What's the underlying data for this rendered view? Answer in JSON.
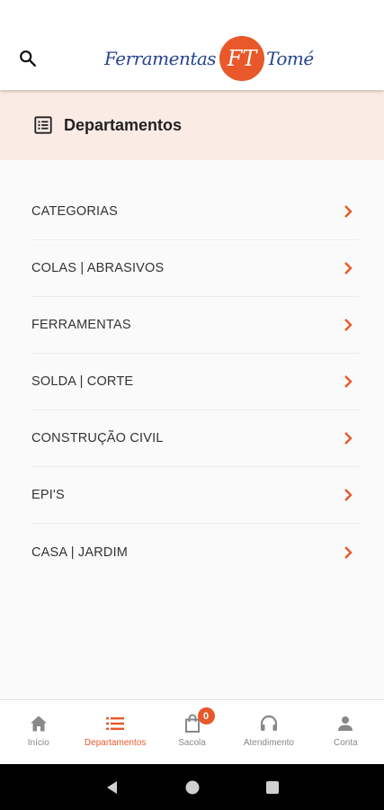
{
  "header": {
    "logo_left": "Ferramentas",
    "logo_mark": "FT",
    "logo_right": "Tomé"
  },
  "section": {
    "title": "Departamentos"
  },
  "menu": {
    "items": [
      {
        "label": "CATEGORIAS"
      },
      {
        "label": "COLAS | ABRASIVOS"
      },
      {
        "label": "FERRAMENTAS"
      },
      {
        "label": "SOLDA | CORTE"
      },
      {
        "label": "CONSTRUÇÃO CIVIL"
      },
      {
        "label": "EPI'S"
      },
      {
        "label": "CASA | JARDIM"
      }
    ]
  },
  "bottom_nav": {
    "items": [
      {
        "label": "Início",
        "icon": "home-icon"
      },
      {
        "label": "Departamentos",
        "icon": "list-icon",
        "active": true
      },
      {
        "label": "Sacola",
        "icon": "bag-icon",
        "badge": "0"
      },
      {
        "label": "Atendimento",
        "icon": "headset-icon"
      },
      {
        "label": "Conta",
        "icon": "person-icon"
      }
    ]
  },
  "colors": {
    "accent": "#e8582a",
    "brand_blue": "#27458f",
    "header_bg": "#fbebe5"
  }
}
